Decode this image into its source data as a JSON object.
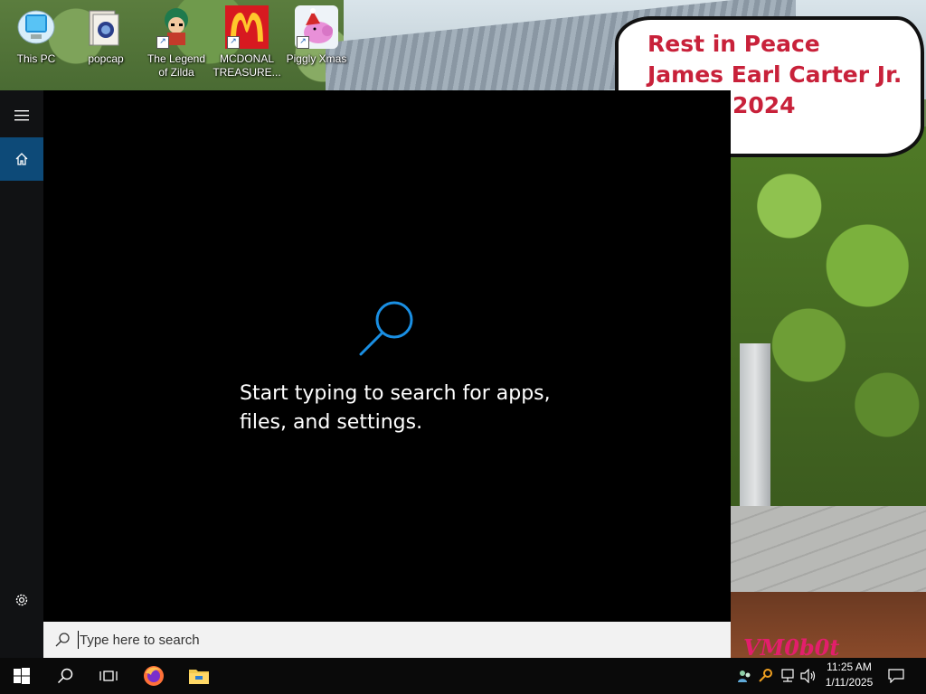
{
  "desktop": {
    "icons": [
      {
        "label": "This PC",
        "icon": "this-pc-icon"
      },
      {
        "label": "popcap",
        "icon": "popcap-icon"
      },
      {
        "label": "The Legend of Zilda",
        "icon": "legend-of-zilda-icon"
      },
      {
        "label": "MCDONAL TREASURE...",
        "icon": "mcdonalds-icon"
      },
      {
        "label": "Piggly Xmas",
        "icon": "piggly-xmas-icon"
      }
    ]
  },
  "wallpaper": {
    "bubble_lines": [
      "Rest in Peace",
      "James Earl Carter Jr.",
      "2024"
    ],
    "watermark": "VM0b0t"
  },
  "start_menu": {
    "hint": "Start typing to search for apps, files, and settings.",
    "search_placeholder": "Type here to search",
    "accent_color": "#0d4a78"
  },
  "taskbar": {
    "pinned": [
      "start-icon",
      "search-icon",
      "task-view-icon",
      "firefox-icon",
      "file-explorer-icon"
    ],
    "tray_icons": [
      "people-icon",
      "key-icon",
      "network-icon",
      "volume-icon"
    ],
    "time": "11:25 AM",
    "date": "1/11/2025"
  }
}
